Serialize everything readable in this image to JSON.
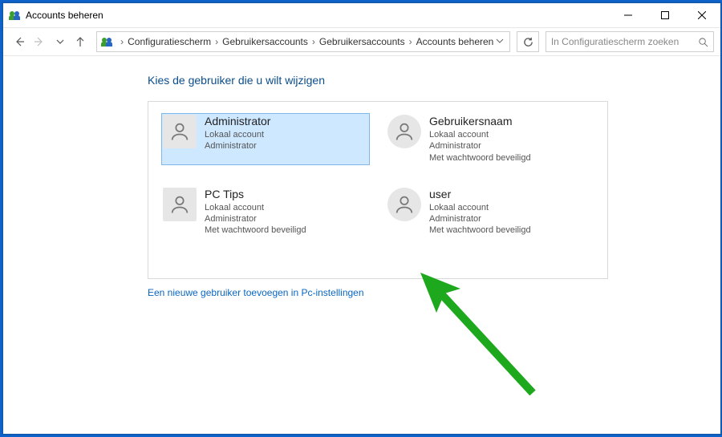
{
  "window": {
    "title": "Accounts beheren"
  },
  "breadcrumb": {
    "items": [
      "Configuratiescherm",
      "Gebruikersaccounts",
      "Gebruikersaccounts",
      "Accounts beheren"
    ]
  },
  "search": {
    "placeholder": "In Configuratiescherm zoeken"
  },
  "page": {
    "heading": "Kies de gebruiker die u wilt wijzigen",
    "add_user_link": "Een nieuwe gebruiker toevoegen in Pc-instellingen"
  },
  "accounts": [
    {
      "name": "Administrator",
      "type": "Lokaal account",
      "role": "Administrator",
      "password": "",
      "selected": true,
      "avatar_shape": "square"
    },
    {
      "name": "Gebruikersnaam",
      "type": "Lokaal account",
      "role": "Administrator",
      "password": "Met wachtwoord beveiligd",
      "selected": false,
      "avatar_shape": "round"
    },
    {
      "name": "PC Tips",
      "type": "Lokaal account",
      "role": "Administrator",
      "password": "Met wachtwoord beveiligd",
      "selected": false,
      "avatar_shape": "square"
    },
    {
      "name": "user",
      "type": "Lokaal account",
      "role": "Administrator",
      "password": "Met wachtwoord beveiligd",
      "selected": false,
      "avatar_shape": "round"
    }
  ]
}
